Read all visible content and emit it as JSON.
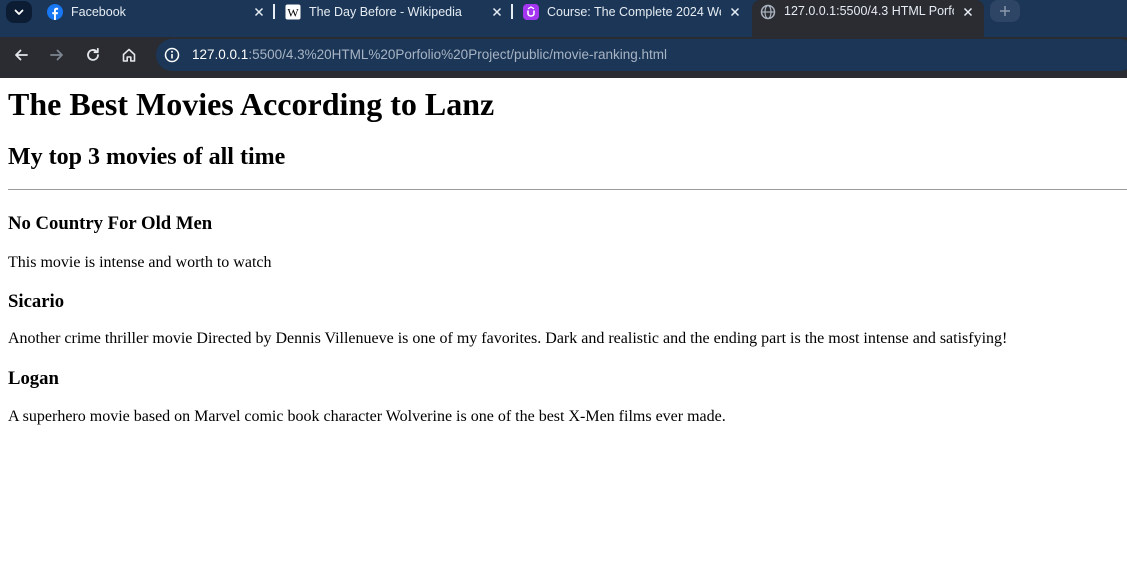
{
  "browser": {
    "tabs": [
      {
        "title": "Facebook",
        "icon": "facebook-icon"
      },
      {
        "title": "The Day Before - Wikipedia",
        "icon": "wikipedia-icon"
      },
      {
        "title": "Course: The Complete 2024 We",
        "icon": "udemy-icon"
      },
      {
        "title": "127.0.0.1:5500/4.3 HTML Porfoli",
        "icon": "globe-icon"
      }
    ],
    "url_host": "127.0.0.1",
    "url_rest": ":5500/4.3%20HTML%20Porfolio%20Project/public/movie-ranking.html",
    "colors": {
      "frame": "#1b3656",
      "toolbar": "#2a2c31",
      "facebook": "#1877f2",
      "udemy": "#a435f0"
    }
  },
  "page": {
    "heading": "The Best Movies According to Lanz",
    "subheading": "My top 3 movies of all time",
    "movies": [
      {
        "title": "No Country For Old Men",
        "description": "This movie is intense and worth to watch"
      },
      {
        "title": "Sicario",
        "description": "Another crime thriller movie Directed by Dennis Villenueve is one of my favorites. Dark and realistic and the ending part is the most intense and satisfying!"
      },
      {
        "title": "Logan",
        "description": "A superhero movie based on Marvel comic book character Wolverine is one of the best X-Men films ever made."
      }
    ]
  }
}
